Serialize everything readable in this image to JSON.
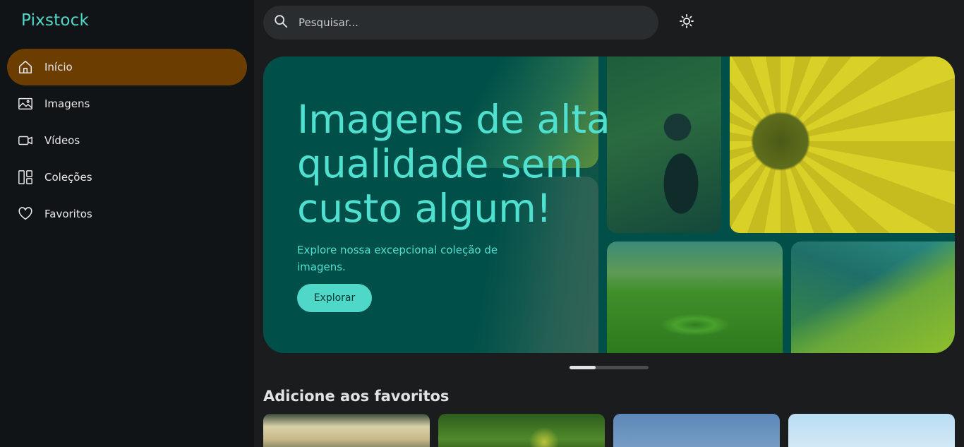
{
  "app": {
    "title": "Pixstock"
  },
  "sidebar": {
    "items": [
      {
        "label": "Início",
        "icon": "home-icon",
        "active": true
      },
      {
        "label": "Imagens",
        "icon": "image-icon",
        "active": false
      },
      {
        "label": "Vídeos",
        "icon": "video-icon",
        "active": false
      },
      {
        "label": "Coleções",
        "icon": "collections-icon",
        "active": false
      },
      {
        "label": "Favoritos",
        "icon": "heart-icon",
        "active": false
      }
    ]
  },
  "search": {
    "placeholder": "Pesquisar..."
  },
  "theme_toggle": {
    "icon": "sun-icon"
  },
  "hero": {
    "title": "Imagens de alta qualidade sem custo algum!",
    "subtitle": "Explore nossa excepcional coleção de imagens.",
    "button_label": "Explorar"
  },
  "favorites": {
    "title": "Adicione aos favoritos"
  },
  "colors": {
    "accent": "#4fd8c8",
    "active_nav": "#6b3e00",
    "hero_bg": "#005049",
    "background": "#1a1c1e",
    "sidebar_bg": "#111416"
  }
}
